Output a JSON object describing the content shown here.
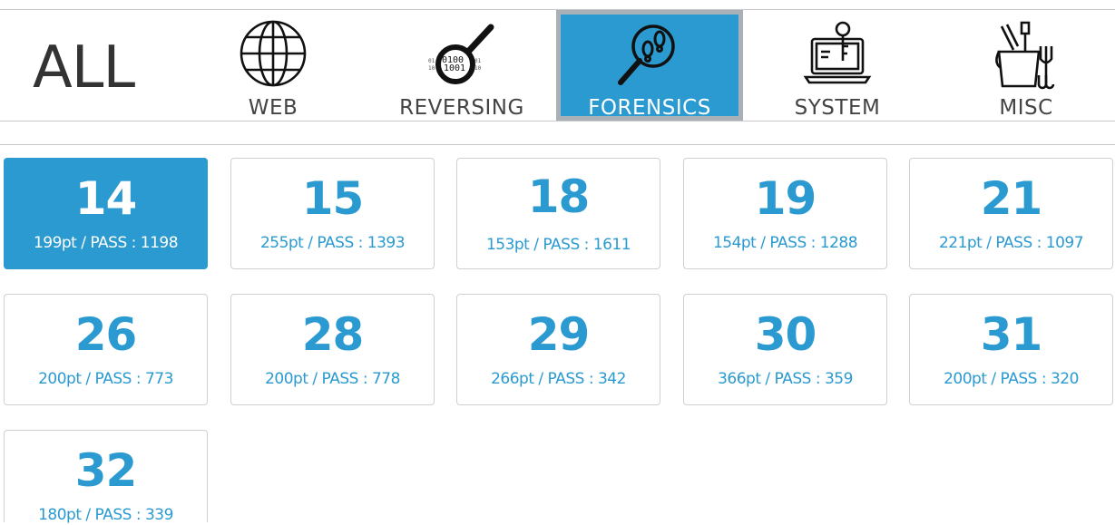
{
  "categories": {
    "all": "ALL",
    "items": [
      {
        "label": "WEB",
        "icon": "globe-icon"
      },
      {
        "label": "REVERSING",
        "icon": "magnifier-binary-icon"
      },
      {
        "label": "FORENSICS",
        "icon": "magnifier-footprints-icon",
        "active": true
      },
      {
        "label": "SYSTEM",
        "icon": "laptop-key-icon"
      },
      {
        "label": "MISC",
        "icon": "bucket-tools-icon"
      }
    ]
  },
  "challenges": [
    {
      "number": "14",
      "info": "199pt / PASS : 1198",
      "solved": true
    },
    {
      "number": "15",
      "info": "255pt / PASS : 1393"
    },
    {
      "number": "18",
      "info": "153pt / PASS : 1611"
    },
    {
      "number": "19",
      "info": "154pt / PASS : 1288"
    },
    {
      "number": "21",
      "info": "221pt / PASS : 1097"
    },
    {
      "number": "26",
      "info": "200pt / PASS : 773"
    },
    {
      "number": "28",
      "info": "200pt / PASS : 778"
    },
    {
      "number": "29",
      "info": "266pt / PASS : 342"
    },
    {
      "number": "30",
      "info": "366pt / PASS : 359"
    },
    {
      "number": "31",
      "info": "200pt / PASS : 320"
    },
    {
      "number": "32",
      "info": "180pt / PASS : 339"
    }
  ],
  "colors": {
    "accent": "#2a9ad1",
    "active_border": "#a9b0b8"
  }
}
